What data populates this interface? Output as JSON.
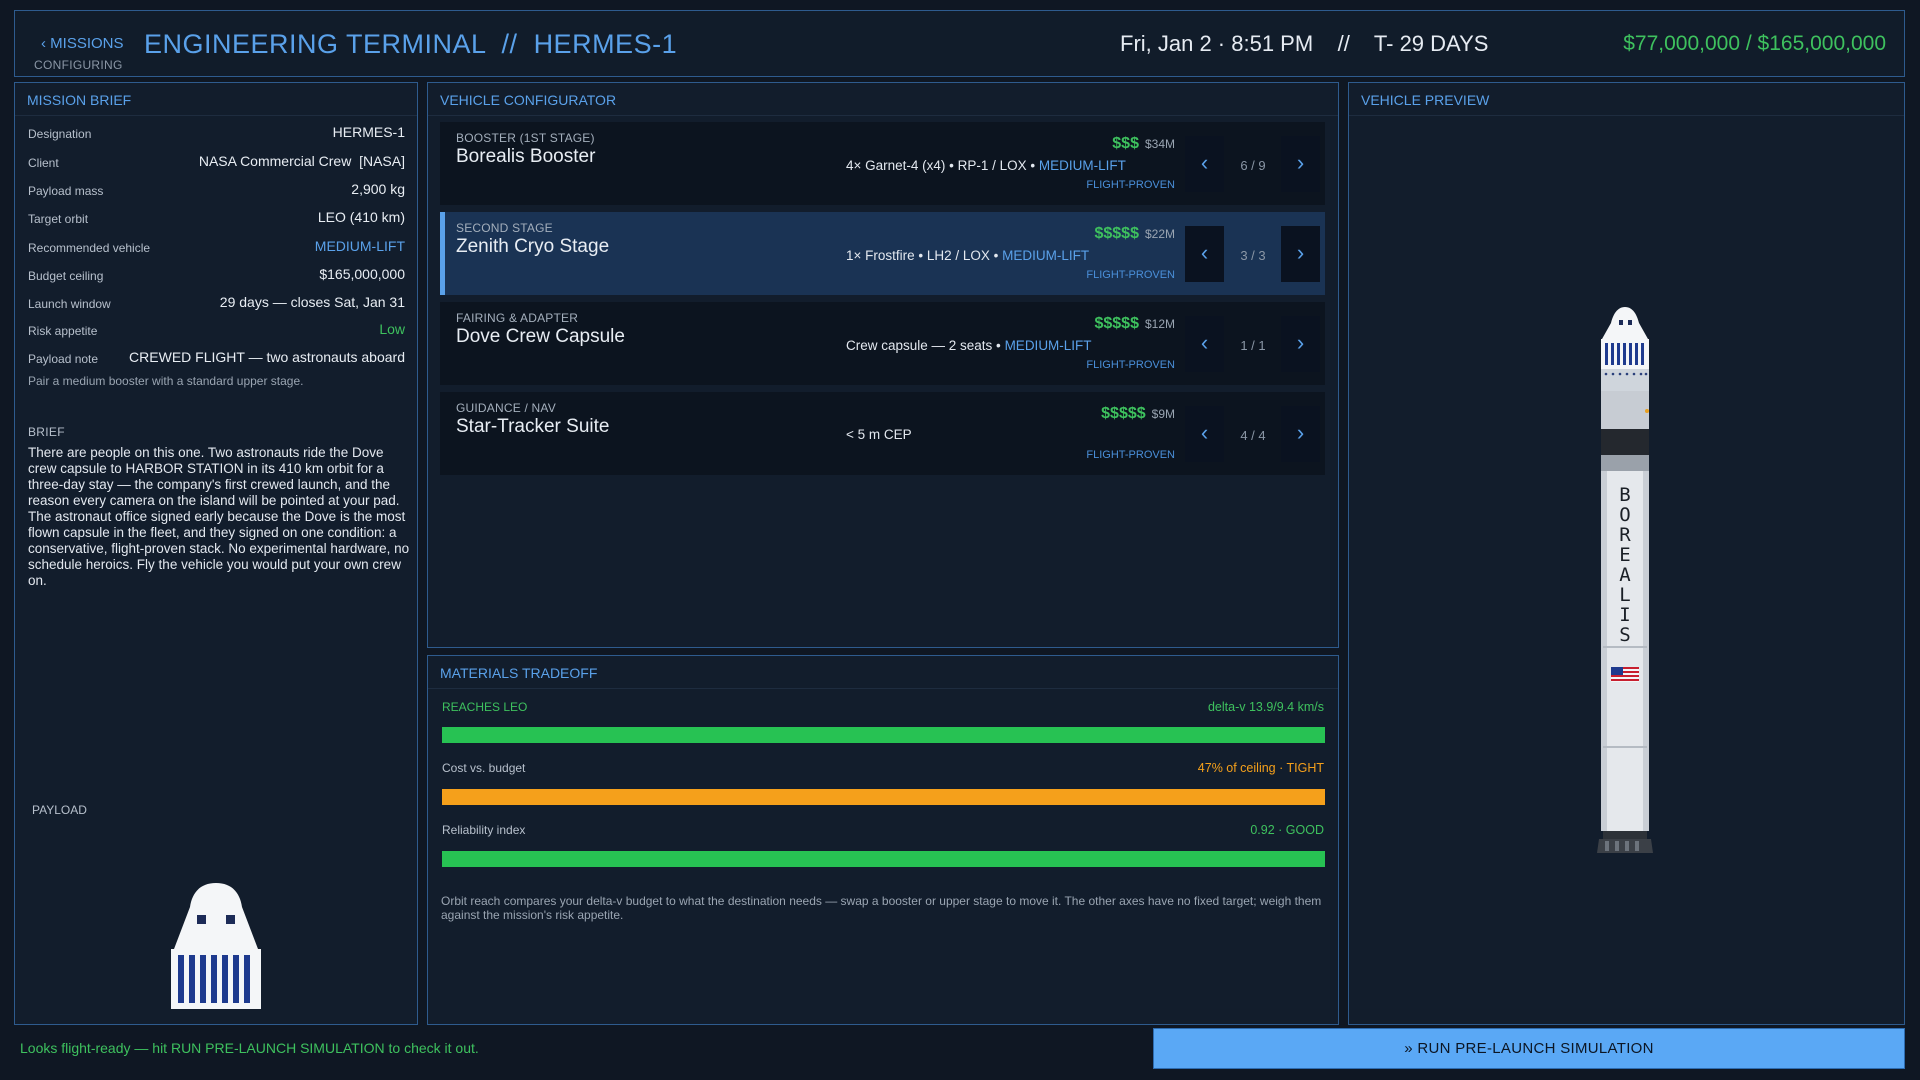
{
  "header": {
    "back_label": "‹ MISSIONS",
    "status": "CONFIGURING",
    "title": "ENGINEERING TERMINAL  //  HERMES-1",
    "datetime": "Fri, Jan 2 · 8:51 PM    //    T- 29 DAYS",
    "budget": "$77,000,000 / $165,000,000"
  },
  "brief": {
    "title": "MISSION BRIEF",
    "rows": [
      {
        "key": "Designation",
        "value": "HERMES-1"
      },
      {
        "key": "Client",
        "value": "NASA Commercial Crew  [NASA]"
      },
      {
        "key": "Payload mass",
        "value": "2,900 kg"
      },
      {
        "key": "Target orbit",
        "value": "LEO (410 km)"
      },
      {
        "key": "Recommended vehicle",
        "value": "MEDIUM-LIFT"
      },
      {
        "key": "Budget ceiling",
        "value": "$165,000,000"
      },
      {
        "key": "Launch window",
        "value": "29 days — closes Sat, Jan 31"
      },
      {
        "key": "Risk appetite",
        "value": "Low"
      },
      {
        "key": "Payload note",
        "value": "CREWED FLIGHT — two astronauts aboard"
      }
    ],
    "pair_note": "Pair a medium booster with a standard upper stage.",
    "section_label": "BRIEF",
    "text": "There are people on this one. Two astronauts ride the Dove crew capsule to HARBOR STATION in its 410 km orbit for a three-day stay — the company's first crewed launch, and the reason every camera on the island will be pointed at your pad. The astronaut office signed early because the Dove is the most flown capsule in the fleet, and they signed on one condition: a conservative, flight-proven stack. No experimental hardware, no schedule heroics. Fly the vehicle you would put your own crew on.",
    "payload_label": "PAYLOAD"
  },
  "configurator": {
    "title": "VEHICLE CONFIGURATOR",
    "stages": [
      {
        "category": "BOOSTER (1ST STAGE)",
        "name": "Borealis Booster",
        "spec": "4× Garnet-4 (x4)  •  RP-1 / LOX  •",
        "class": "MEDIUM-LIFT",
        "dollars": "$$$",
        "cost": "$34M",
        "status": "FLIGHT-PROVEN",
        "counter": "6 / 9"
      },
      {
        "category": "SECOND STAGE",
        "name": "Zenith Cryo Stage",
        "spec": "1× Frostfire  •  LH2 / LOX  •",
        "class": "MEDIUM-LIFT",
        "dollars": "$$$$$",
        "cost": "$22M",
        "status": "FLIGHT-PROVEN",
        "counter": "3 / 3"
      },
      {
        "category": "FAIRING & ADAPTER",
        "name": "Dove Crew Capsule",
        "spec": "Crew capsule — 2 seats  •",
        "class": "MEDIUM-LIFT",
        "dollars": "$$$$$",
        "cost": "$12M",
        "status": "FLIGHT-PROVEN",
        "counter": "1 / 1"
      },
      {
        "category": "GUIDANCE / NAV",
        "name": "Star-Tracker Suite",
        "spec": "< 5 m CEP",
        "class": "",
        "dollars": "$$$$$",
        "cost": "$9M",
        "status": "FLIGHT-PROVEN",
        "counter": "4 / 4"
      }
    ],
    "arrow_left": "‹",
    "arrow_right": "›"
  },
  "materials": {
    "title": "MATERIALS TRADEOFF",
    "rows": [
      {
        "label": "REACHES LEO",
        "value": "delta-v 13.9/9.4 km/s",
        "fill_pct": 100,
        "color": "#27c253"
      },
      {
        "label": "Cost vs. budget",
        "value": "47% of ceiling  · TIGHT",
        "fill_pct": 100,
        "color": "#f5a01b"
      },
      {
        "label": "Reliability index",
        "value": "0.92  · GOOD",
        "fill_pct": 100,
        "color": "#27c253"
      }
    ],
    "note": "Orbit reach compares your delta-v budget to what the destination needs — swap a booster or upper stage to move it. The other axes have no fixed target; weigh them against the mission's risk appetite."
  },
  "preview": {
    "title": "VEHICLE PREVIEW",
    "rocket_lettering": "BOREALIS"
  },
  "footer": {
    "message": "Looks flight-ready — hit RUN PRE-LAUNCH SIMULATION to check it out.",
    "run_label": "»  RUN PRE-LAUNCH SIMULATION"
  },
  "colors": {
    "accent": "#5aa1ea",
    "good": "#3ec15e",
    "warn": "#f5a01b",
    "button": "#5aa8f5"
  }
}
